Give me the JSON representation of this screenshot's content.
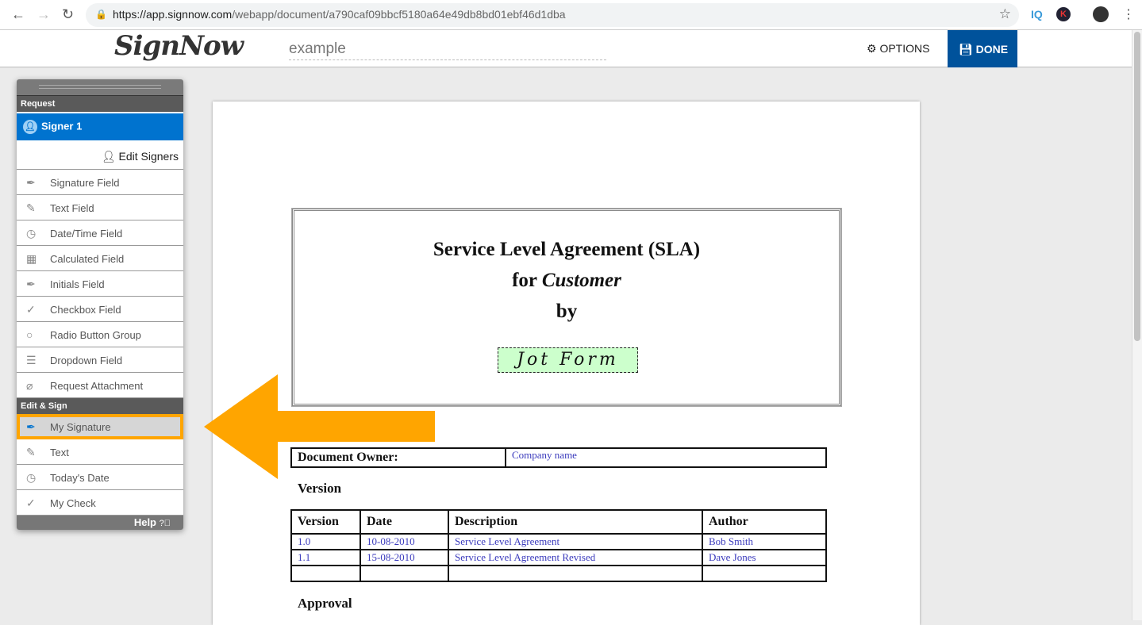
{
  "browser": {
    "url_host": "https://app.signnow.com",
    "url_path": "/webapp/document/a790caf09bbcf5180a64e49db8bd01ebf46d1dba",
    "ext_iq": "IQ",
    "ext_k": "K"
  },
  "header": {
    "logo": "SignNow",
    "document_name": "example",
    "options_label": "OPTIONS",
    "done_label": "DONE",
    "done_color": "#00529b"
  },
  "panel": {
    "request_header": "Request",
    "signer": "Signer 1",
    "edit_signers": "Edit Signers",
    "request_items": [
      {
        "label": "Signature Field",
        "icon": "pen-nib-icon"
      },
      {
        "label": "Text Field",
        "icon": "pencil-icon"
      },
      {
        "label": "Date/Time Field",
        "icon": "clock-icon"
      },
      {
        "label": "Calculated Field",
        "icon": "calculator-icon"
      },
      {
        "label": "Initials Field",
        "icon": "pen-nib-icon"
      },
      {
        "label": "Checkbox Field",
        "icon": "check-icon"
      },
      {
        "label": "Radio Button Group",
        "icon": "radio-icon"
      },
      {
        "label": "Dropdown Field",
        "icon": "dropdown-icon"
      },
      {
        "label": "Request Attachment",
        "icon": "paperclip-icon"
      }
    ],
    "edit_header": "Edit & Sign",
    "edit_items": [
      {
        "label": "My Signature",
        "icon": "pen-nib-icon",
        "selected": true
      },
      {
        "label": "Text",
        "icon": "pencil-icon"
      },
      {
        "label": "Today's Date",
        "icon": "clock-icon"
      },
      {
        "label": "My Check",
        "icon": "check-icon"
      }
    ],
    "help": "Help",
    "highlight_color": "#ffa500"
  },
  "document": {
    "title1": "Service Level Agreement (SLA)",
    "title2_prefix": "for ",
    "title2_italic": "Customer",
    "title3": "by",
    "signature": "Jot Form",
    "owner_label": "Document Owner:",
    "owner_value": "Company name",
    "version_heading": "Version",
    "version_table": {
      "headers": [
        "Version",
        "Date",
        "Description",
        "Author"
      ],
      "rows": [
        [
          "1.0",
          "10-08-2010",
          "Service Level Agreement",
          "Bob Smith"
        ],
        [
          "1.1",
          "15-08-2010",
          "Service Level Agreement Revised",
          "Dave Jones"
        ],
        [
          "",
          "",
          "",
          ""
        ]
      ]
    },
    "approval_heading": "Approval"
  }
}
